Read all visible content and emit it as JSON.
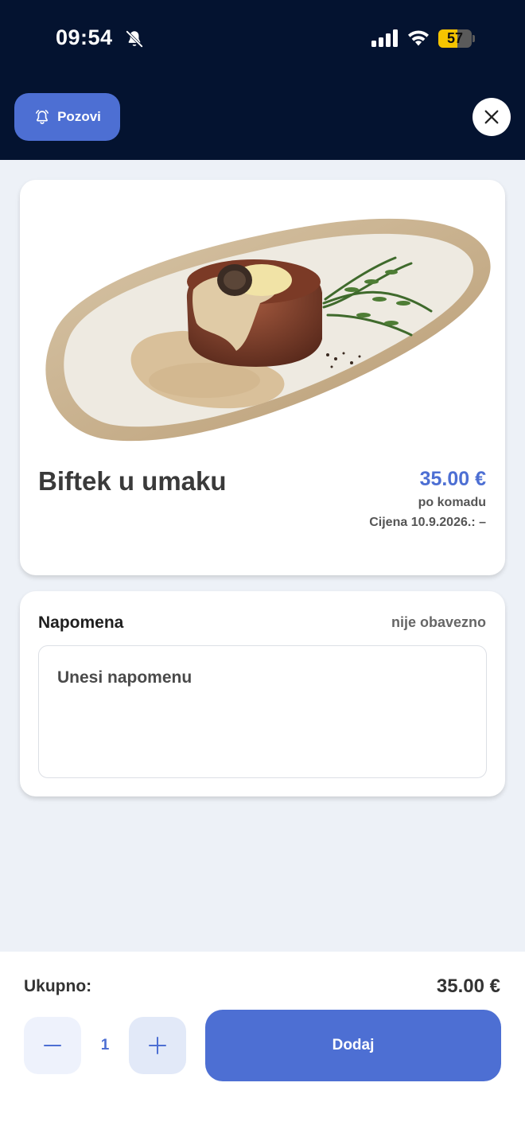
{
  "status_bar": {
    "time": "09:54",
    "battery_level": "57",
    "battery_fraction": 0.57
  },
  "header": {
    "call_button_label": "Pozovi",
    "accent_color": "#4d6fd3",
    "background_color": "#041330"
  },
  "product": {
    "name": "Biftek u umaku",
    "price": "35.00 €",
    "unit": "po komadu",
    "date_price": "Cijena 10.9.2026.: –"
  },
  "note": {
    "title": "Napomena",
    "optional_label": "nije obavezno",
    "placeholder": "Unesi napomenu",
    "value": ""
  },
  "footer": {
    "total_label": "Ukupno:",
    "total_value": "35.00 €",
    "quantity": "1",
    "add_button_label": "Dodaj"
  },
  "icons": {
    "bell_off": "bell-off-icon",
    "signal": "signal-icon",
    "wifi": "wifi-icon",
    "battery": "battery-icon",
    "bell": "bell-icon",
    "close": "close-icon",
    "minus": "minus-icon",
    "plus": "plus-icon"
  }
}
